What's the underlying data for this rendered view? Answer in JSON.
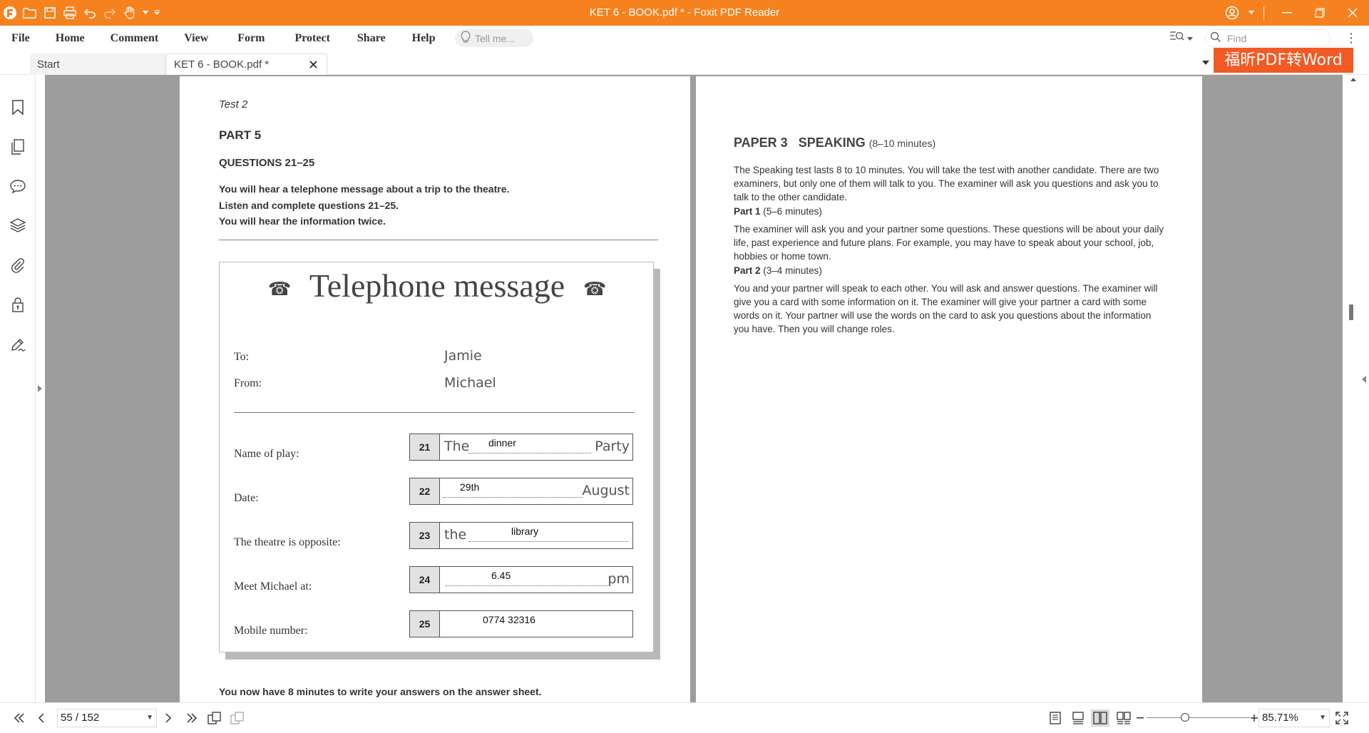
{
  "app": {
    "window_title": "KET 6 - BOOK.pdf * - Foxit PDF Reader",
    "accent_color": "#f5821f"
  },
  "menubar": {
    "items": [
      "File",
      "Home",
      "Comment",
      "View",
      "Form",
      "Protect",
      "Share",
      "Help"
    ],
    "tell_me_placeholder": "Tell me...",
    "find_placeholder": "Find"
  },
  "tabs": {
    "start_label": "Start",
    "doc_label": "KET 6 - BOOK.pdf *"
  },
  "convert_button": "福昕PDF转Word",
  "left_page": {
    "test_label": "Test 2",
    "part": "PART 5",
    "questions": "QUESTIONS 21–25",
    "instructions": [
      "You will hear a telephone message about a trip to the theatre.",
      "Listen and complete questions 21–25.",
      "You will hear the information twice."
    ],
    "message_title": "Telephone message",
    "to_label": "To:",
    "to_value": "Jamie",
    "from_label": "From:",
    "from_value": "Michael",
    "rows": [
      {
        "label": "Name of play:",
        "num": "21",
        "pre": "The",
        "answer": "dinner",
        "post": "Party"
      },
      {
        "label": "Date:",
        "num": "22",
        "pre": "",
        "answer": "29th",
        "post": "August"
      },
      {
        "label": "The theatre is opposite:",
        "num": "23",
        "pre": "the",
        "answer": "library",
        "post": ""
      },
      {
        "label": "Meet Michael at:",
        "num": "24",
        "pre": "",
        "answer": "6.45",
        "post": "pm"
      },
      {
        "label": "Mobile number:",
        "num": "25",
        "pre": "",
        "answer": "0774 32316",
        "post": ""
      }
    ],
    "final_note": "You now have 8 minutes to write your answers on the answer sheet."
  },
  "right_page": {
    "heading": "PAPER 3   SPEAKING",
    "heading_sub": "(8–10 minutes)",
    "intro": "The Speaking test lasts 8 to 10 minutes. You will take the test with another candidate. There are two examiners, but only one of them will talk to you. The examiner will ask you questions and ask you to talk to the other candidate.",
    "part1_title": "Part 1",
    "part1_time": "(5–6 minutes)",
    "part1_text": "The examiner will ask you and your partner some questions. These questions will be about your daily life, past experience and future plans. For example, you may have to speak about your school, job, hobbies or home town.",
    "part2_title": "Part 2",
    "part2_time": "(3–4 minutes)",
    "part2_text": "You and your partner will speak to each other. You will ask and answer questions. The examiner will give you a card with some information on it. The examiner will give your partner a card with some words on it. Your partner will use the words on the card to ask you questions about the information you have. Then you will change roles."
  },
  "statusbar": {
    "page_indicator": "55 / 152",
    "zoom": "85.71%",
    "zoom_fraction": 0.37
  }
}
